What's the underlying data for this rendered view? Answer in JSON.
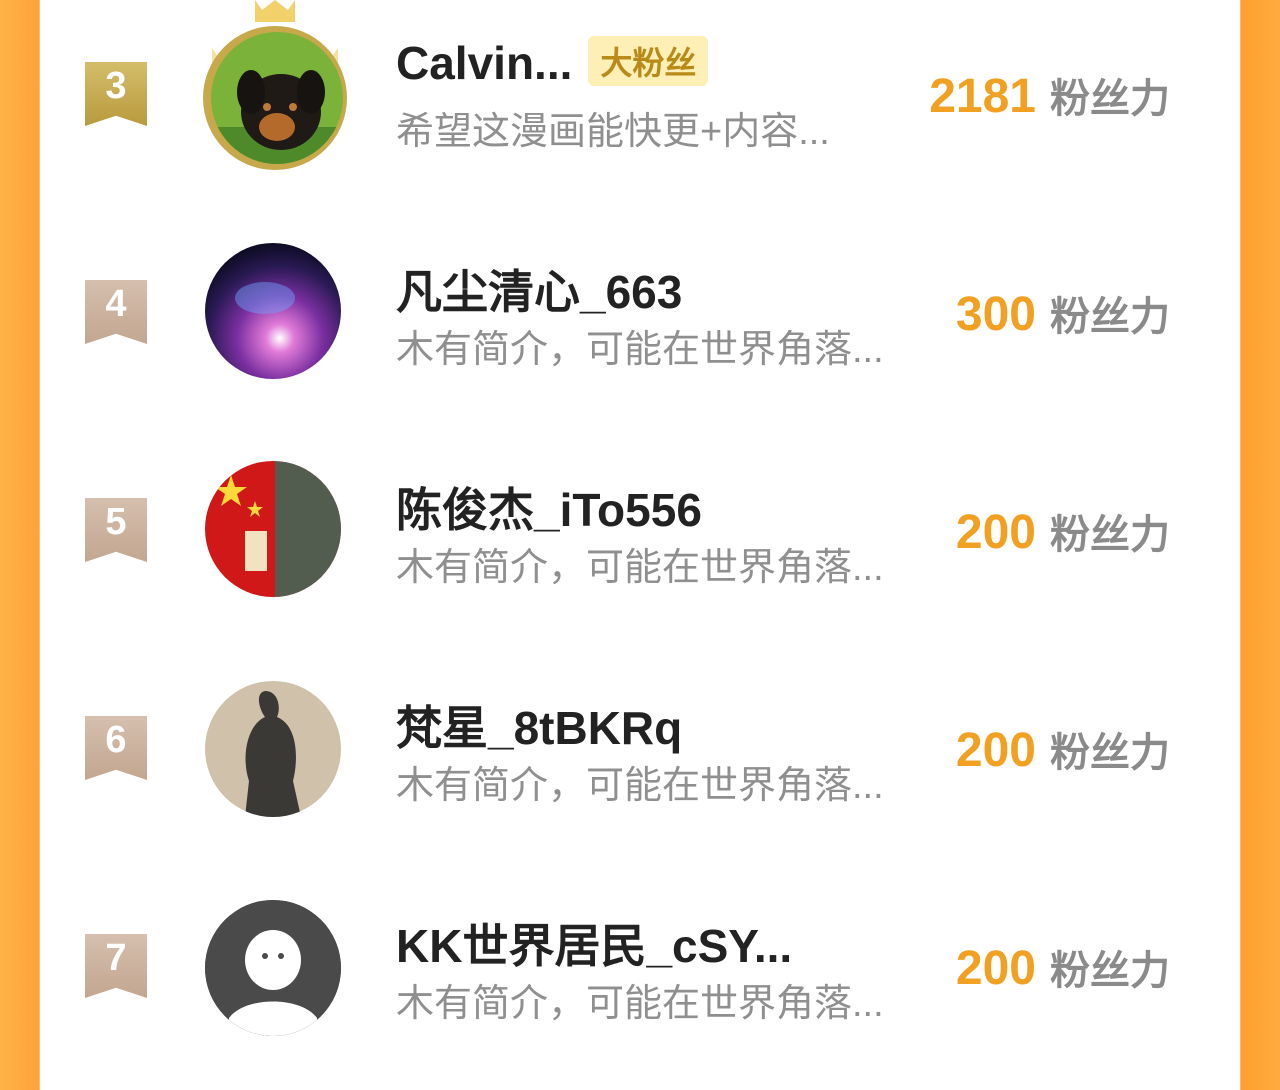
{
  "score_unit": "粉丝力",
  "fans": [
    {
      "rank": "3",
      "name": "Calvin...",
      "badge": "大粉丝",
      "desc": "希望这漫画能快更+内容...",
      "score": "2181",
      "avatar_icon": "rottweiler-puppy-avatar",
      "frame": "gold-winged-crown"
    },
    {
      "rank": "4",
      "name": "凡尘清心_663",
      "desc": "木有简介，可能在世界角落...",
      "score": "300",
      "avatar_icon": "nebula-avatar"
    },
    {
      "rank": "5",
      "name": "陈俊杰_iTo556",
      "desc": "木有简介，可能在世界角落...",
      "score": "200",
      "avatar_icon": "red-flag-warrior-avatar"
    },
    {
      "rank": "6",
      "name": "梵星_8tBKRq",
      "desc": "木有简介，可能在世界角落...",
      "score": "200",
      "avatar_icon": "shadow-photo-avatar"
    },
    {
      "rank": "7",
      "name": "KK世界居民_cSY...",
      "desc": "木有简介，可能在世界角落...",
      "score": "200",
      "avatar_icon": "default-person-avatar"
    }
  ],
  "colors": {
    "accent_orange": "#f2a022",
    "side_bg": "#ffa23a",
    "badge_bg": "#fdefb5"
  }
}
